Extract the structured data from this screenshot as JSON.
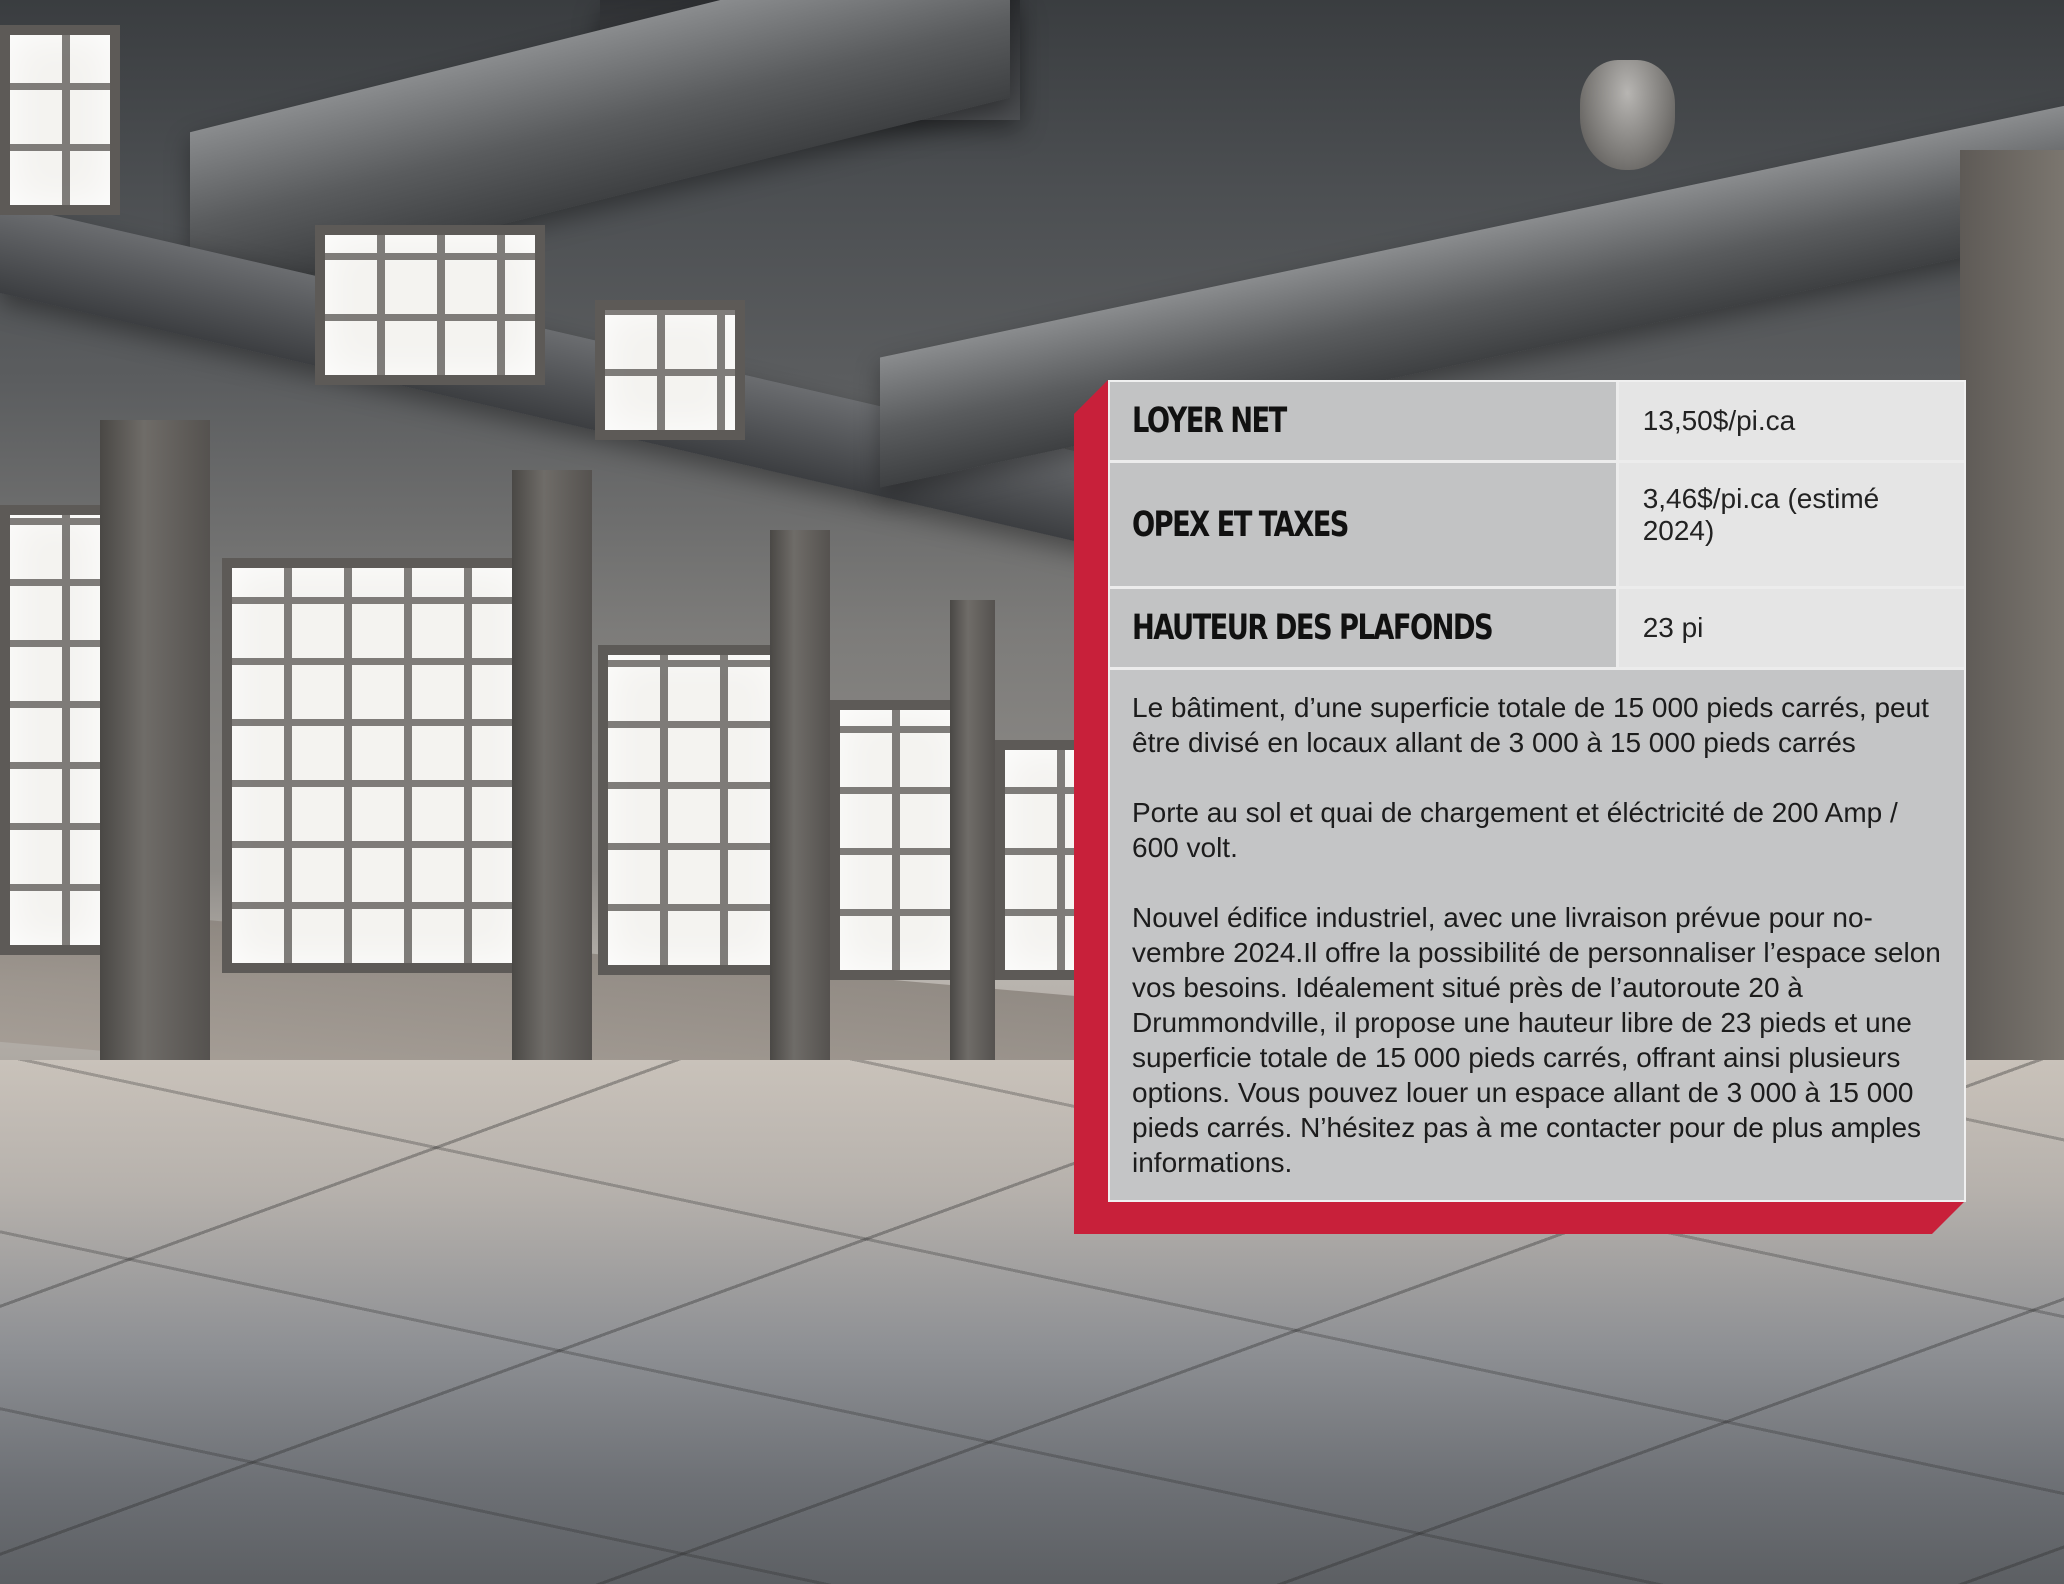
{
  "specs": [
    {
      "label": "LOYER NET",
      "value": "13,50$/pi.ca"
    },
    {
      "label": "OPEX ET TAXES",
      "value": "3,46$/pi.ca (estimé 2024)"
    },
    {
      "label": "HAUTEUR DES PLAFONDS",
      "value": "23 pi"
    }
  ],
  "description": {
    "paragraph_1": "Le bâtiment, d’une superficie totale de 15 000 pieds carrés, peut être divisé en locaux allant de 3 000 à 15 000 pieds carrés",
    "paragraph_2": "Porte au sol et quai de chargement et éléctricité de 200 Amp / 600 volt.",
    "paragraph_3": "Nouvel édifice industriel, avec une livraison prévue pour no-vembre 2024.Il offre la possibilité de personnaliser l’espace selon vos besoins. Idéalement situé près de l’autoroute 20 à Drummondville, il propose une hauteur libre de 23 pieds et une superficie totale de 15 000 pieds carrés, offrant ainsi plusieurs options. Vous pouvez louer un espace allant de 3 000 à 15 000 pieds carrés. N’hésitez pas à me contacter pour de plus amples informations."
  },
  "colors": {
    "accent": "#c8203a",
    "label_bg": "#c2c3c4",
    "value_bg": "#e5e5e5"
  }
}
